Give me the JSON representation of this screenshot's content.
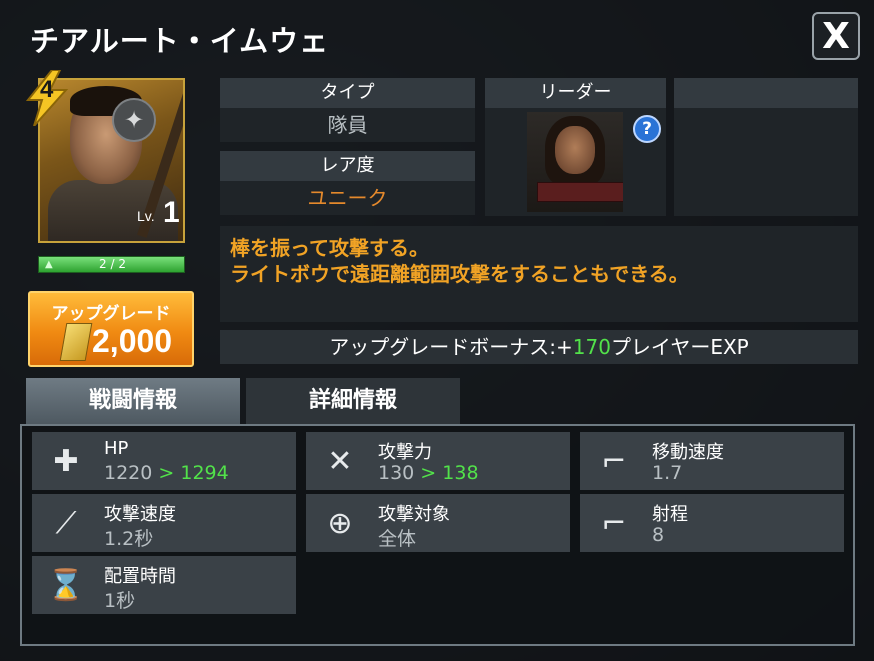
{
  "title": "チアルート・イムウェ",
  "close_label": "X",
  "unit": {
    "tier": "4",
    "level_prefix": "Lv.",
    "level": "1",
    "shards": "2 / 2",
    "shard_fill": 1.0
  },
  "upgrade": {
    "label": "アップグレード",
    "cost": "2,000"
  },
  "info": {
    "type_header": "タイプ",
    "type_value": "隊員",
    "rarity_header": "レア度",
    "rarity_value": "ユニーク",
    "leader_header": "リーダー",
    "help_label": "?"
  },
  "description": {
    "line1": "棒を振って攻撃する。",
    "line2": "ライトボウで遠距離範囲攻撃をすることもできる。"
  },
  "bonus": {
    "prefix": "アップグレードボーナス:+",
    "value": "170",
    "suffix": "プレイヤーEXP"
  },
  "tabs": [
    {
      "label": "戦闘情報",
      "active": true
    },
    {
      "label": "詳細情報",
      "active": false
    }
  ],
  "stats": [
    {
      "icon": "health-cross-icon",
      "label": "HP",
      "value": "1220",
      "arrow": " > ",
      "upgraded": "1294"
    },
    {
      "icon": "crossed-swords-icon",
      "label": "攻撃力",
      "value": "130",
      "arrow": " > ",
      "upgraded": "138"
    },
    {
      "icon": "boot-icon",
      "label": "移動速度",
      "value": "1.7"
    },
    {
      "icon": "slash-speed-icon",
      "label": "攻撃速度",
      "value": "1.2秒"
    },
    {
      "icon": "crosshair-icon",
      "label": "攻撃対象",
      "value": "全体"
    },
    {
      "icon": "blaster-icon",
      "label": "射程",
      "value": "8"
    },
    {
      "icon": "hourglass-icon",
      "label": "配置時間",
      "value": "1秒"
    }
  ],
  "colors": {
    "rarity": "#e4892c",
    "description": "#f1a325",
    "upgrade_green": "#52e24a",
    "upgrade_button": "#f08a12"
  }
}
